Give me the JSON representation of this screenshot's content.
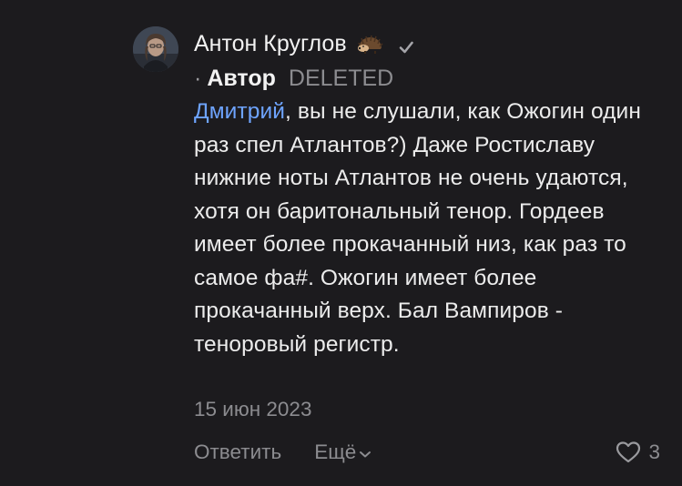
{
  "author": {
    "name": "Антон Круглов",
    "badge_icon": "hedgehog-icon",
    "verified_icon": "checkmark-icon",
    "separator": "·",
    "role": "Автор",
    "status": "DELETED"
  },
  "comment": {
    "mention": "Дмитрий",
    "text": ", вы не слушали, как Ожогин один раз спел Атлантов?) Даже Ростиславу нижние ноты Атлантов не очень удаются, хотя он баритональный тенор. Гордеев имеет более прокачанный низ, как раз то самое фа#. Ожогин имеет более прокачанный верх. Бал Вампиров - теноровый регистр."
  },
  "date": "15 июн 2023",
  "actions": {
    "reply_label": "Ответить",
    "more_label": "Ещё",
    "like_count": "3"
  },
  "colors": {
    "background": "#1c1b1e",
    "text": "#ececec",
    "mention": "#6ea4ff",
    "muted": "#8c8c90"
  }
}
